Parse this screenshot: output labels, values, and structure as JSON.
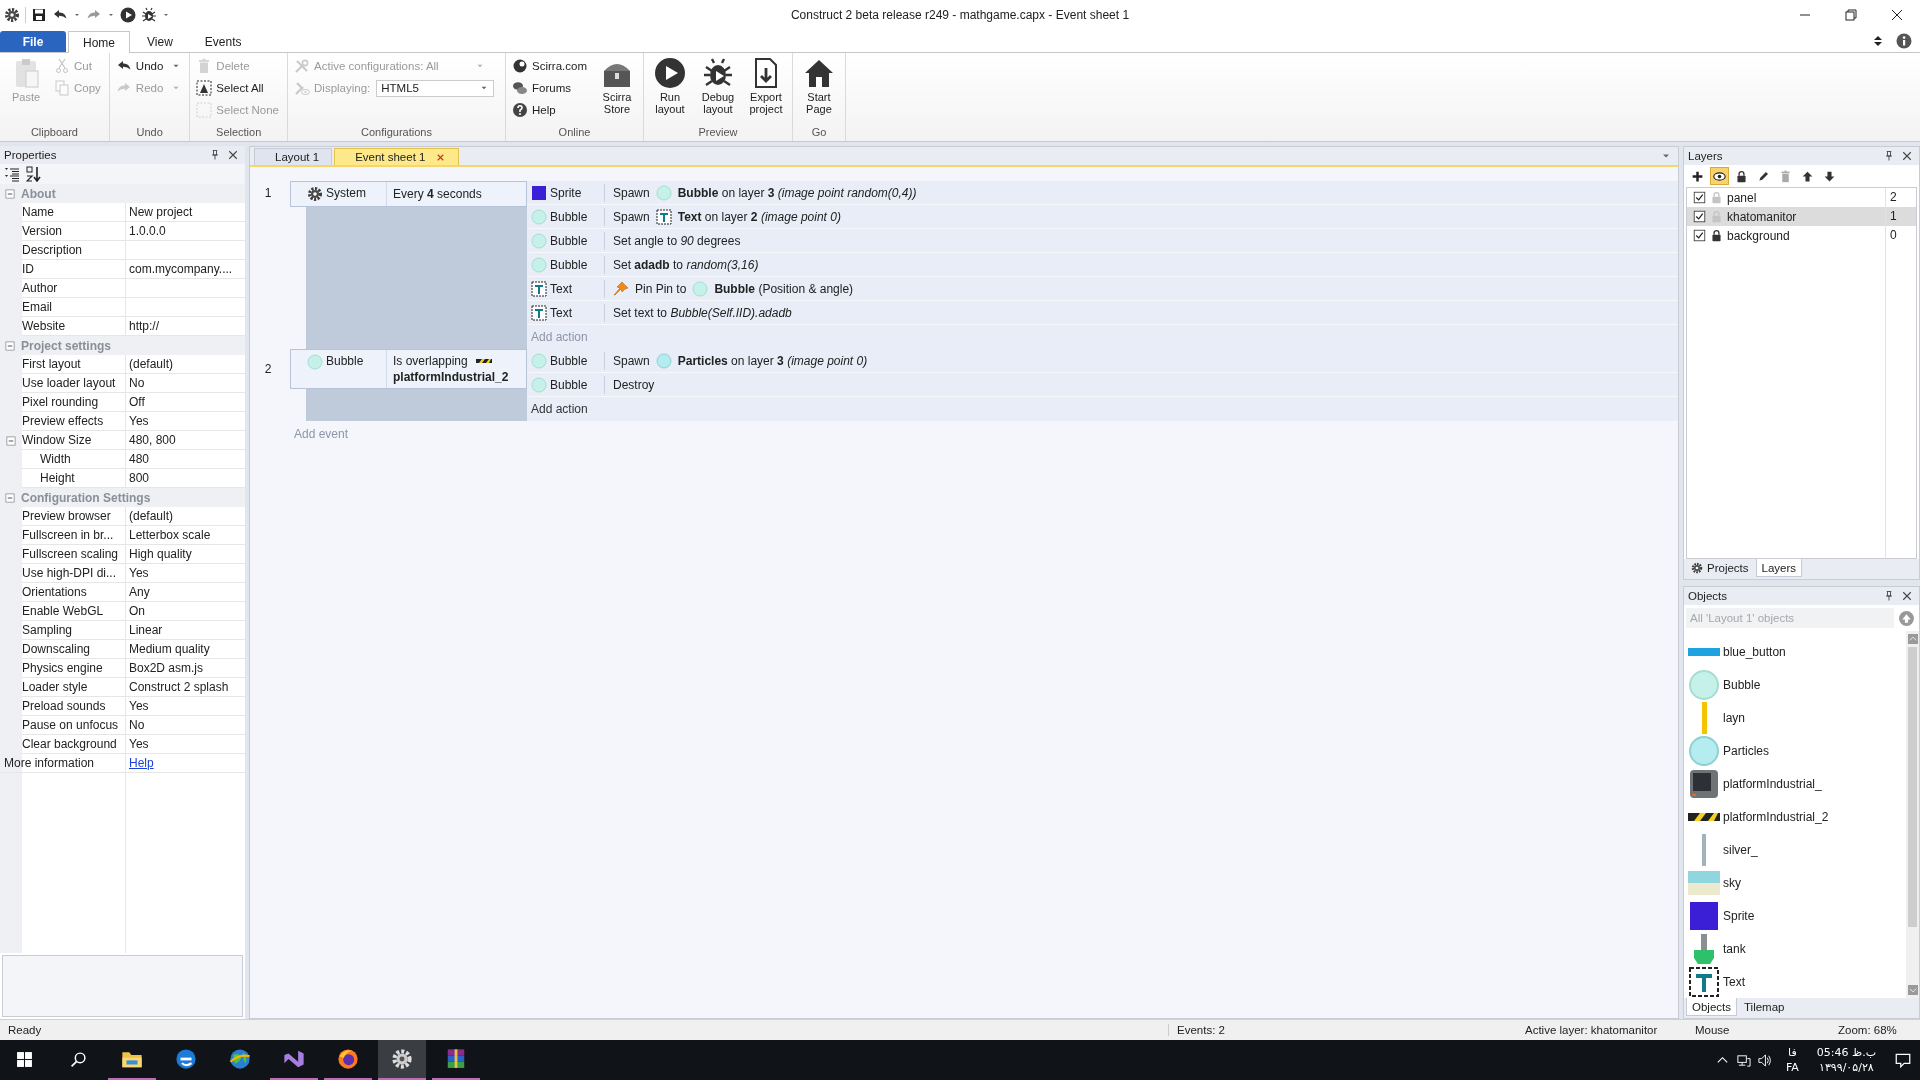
{
  "window": {
    "title": "Construct 2 beta release r249 - mathgame.capx - Event sheet 1"
  },
  "ribbon": {
    "tabs": [
      {
        "label": "File",
        "kind": "file",
        "selected": false
      },
      {
        "label": "Home",
        "kind": "tab",
        "selected": true
      },
      {
        "label": "View",
        "kind": "tab",
        "selected": false
      },
      {
        "label": "Events",
        "kind": "tab",
        "selected": false
      }
    ],
    "groups": [
      {
        "label": "Clipboard",
        "columns": [
          {
            "items": [
              {
                "label": "Paste",
                "kind": "large",
                "disabled": true
              }
            ]
          },
          {
            "items": [
              {
                "label": "Cut",
                "kind": "small",
                "disabled": true
              },
              {
                "label": "Copy",
                "kind": "small",
                "disabled": true
              }
            ]
          }
        ]
      },
      {
        "label": "Undo",
        "columns": [
          {
            "items": [
              {
                "label": "Undo",
                "kind": "small",
                "disabled": false,
                "dropdown": true
              },
              {
                "label": "Redo",
                "kind": "small",
                "disabled": true,
                "dropdown": true
              }
            ]
          }
        ]
      },
      {
        "label": "Selection",
        "columns": [
          {
            "items": [
              {
                "label": "Delete",
                "kind": "small",
                "disabled": true
              },
              {
                "label": "Select All",
                "kind": "small",
                "disabled": false
              },
              {
                "label": "Select None",
                "kind": "small",
                "disabled": true
              }
            ]
          }
        ]
      },
      {
        "label": "Configurations",
        "columns": [
          {
            "items": [
              {
                "label": "Active configurations: All",
                "kind": "small",
                "disabled": true,
                "dropdown": true
              },
              {
                "label": "Displaying:",
                "kind": "combo",
                "disabled": true,
                "value": "HTML5"
              }
            ]
          }
        ]
      },
      {
        "label": "Online",
        "columns": [
          {
            "items": [
              {
                "label": "Scirra.com",
                "kind": "small",
                "disabled": false
              },
              {
                "label": "Forums",
                "kind": "small",
                "disabled": false
              },
              {
                "label": "Help",
                "kind": "small",
                "disabled": false
              }
            ]
          },
          {
            "items": [
              {
                "label": "Scirra Store",
                "kind": "large",
                "disabled": false
              }
            ]
          }
        ]
      },
      {
        "label": "Preview",
        "columns": [
          {
            "items": [
              {
                "label": "Run layout",
                "kind": "large",
                "disabled": false
              }
            ]
          },
          {
            "items": [
              {
                "label": "Debug layout",
                "kind": "large",
                "disabled": false
              }
            ]
          },
          {
            "items": [
              {
                "label": "Export project",
                "kind": "large",
                "disabled": false
              }
            ]
          }
        ]
      },
      {
        "label": "Go",
        "columns": [
          {
            "items": [
              {
                "label": "Start Page",
                "kind": "large",
                "disabled": false
              }
            ]
          }
        ]
      }
    ]
  },
  "properties": {
    "title": "Properties",
    "sections": [
      {
        "label": "About",
        "expanded": true,
        "rows": [
          {
            "name": "Name",
            "value": "New project"
          },
          {
            "name": "Version",
            "value": "1.0.0.0"
          },
          {
            "name": "Description"
          },
          {
            "name": "ID",
            "value": "com.mycompany...."
          },
          {
            "name": "Author"
          },
          {
            "name": "Email"
          },
          {
            "name": "Website",
            "value": "http://"
          }
        ]
      },
      {
        "label": "Project settings",
        "expanded": true,
        "rows": [
          {
            "name": "First layout",
            "value": "(default)"
          },
          {
            "name": "Use loader layout",
            "value": "No"
          },
          {
            "name": "Pixel rounding",
            "value": "Off"
          },
          {
            "name": "Preview effects",
            "value": "Yes"
          },
          {
            "name": "Window Size",
            "value": "480, 800",
            "expanded": true,
            "children": [
              {
                "name": "Width",
                "value": "480"
              },
              {
                "name": "Height",
                "value": "800"
              }
            ]
          }
        ]
      },
      {
        "label": "Configuration Settings",
        "expanded": true,
        "rows": [
          {
            "name": "Preview browser",
            "value": "(default)"
          },
          {
            "name": "Fullscreen in br...",
            "value": "Letterbox scale"
          },
          {
            "name": "Fullscreen scaling",
            "value": "High quality"
          },
          {
            "name": "Use high-DPI di...",
            "value": "Yes"
          },
          {
            "name": "Orientations",
            "value": "Any"
          },
          {
            "name": "Enable WebGL",
            "value": "On"
          },
          {
            "name": "Sampling",
            "value": "Linear"
          },
          {
            "name": "Downscaling",
            "value": "Medium quality"
          },
          {
            "name": "Physics engine",
            "value": "Box2D asm.js"
          },
          {
            "name": "Loader style",
            "value": "Construct 2 splash"
          },
          {
            "name": "Preload sounds",
            "value": "Yes"
          },
          {
            "name": "Pause on unfocus",
            "value": "No"
          },
          {
            "name": "Clear background",
            "value": "Yes"
          }
        ]
      }
    ],
    "footer": {
      "name": "More information",
      "link": "Help"
    }
  },
  "editor": {
    "tabs": [
      {
        "label": "Layout 1",
        "selected": false,
        "closable": false
      },
      {
        "label": "Event sheet 1",
        "selected": true,
        "closable": true
      }
    ],
    "events": [
      {
        "number": "1",
        "condition": {
          "object": "System",
          "kind": "system",
          "parts": [
            {
              "kind": "text",
              "text": "Every **4** seconds"
            }
          ]
        },
        "actions": [
          {
            "object": "Sprite",
            "kind": "sprite",
            "parts": [
              {
                "kind": "text",
                "text": "Spawn"
              },
              {
                "kind": "bubble"
              },
              {
                "kind": "text",
                "text": "**Bubble** on layer **3** *(image point random(0,4))*"
              }
            ]
          },
          {
            "object": "Bubble",
            "kind": "bubble",
            "parts": [
              {
                "kind": "text",
                "text": "Spawn"
              },
              {
                "kind": "text_object"
              },
              {
                "kind": "text",
                "text": "**Text** on layer **2** *(image point 0)*"
              }
            ]
          },
          {
            "object": "Bubble",
            "kind": "bubble",
            "parts": [
              {
                "kind": "text",
                "text": "Set angle to *90* degrees"
              }
            ]
          },
          {
            "object": "Bubble",
            "kind": "bubble",
            "parts": [
              {
                "kind": "text",
                "text": "Set **adadb** to *random(3,16)*"
              }
            ]
          },
          {
            "object": "Text",
            "kind": "text_object",
            "parts": [
              {
                "kind": "pin"
              },
              {
                "kind": "text",
                "text": "Pin Pin to"
              },
              {
                "kind": "bubble"
              },
              {
                "kind": "text",
                "text": "**Bubble** (Position & angle)"
              }
            ]
          },
          {
            "object": "Text",
            "kind": "text_object",
            "parts": [
              {
                "kind": "text",
                "text": "Set text to *Bubble(Self.IID).adadb*"
              }
            ]
          }
        ],
        "add_action": {
          "label": "Add action",
          "muted": true
        }
      },
      {
        "number": "2",
        "condition": {
          "object": "Bubble",
          "kind": "bubble",
          "parts": [
            {
              "kind": "text",
              "text": "Is overlapping"
            },
            {
              "kind": "platform2"
            },
            {
              "kind": "text",
              "text": "**platformIndustrial_2**"
            }
          ]
        },
        "actions": [
          {
            "object": "Bubble",
            "kind": "bubble",
            "parts": [
              {
                "kind": "text",
                "text": "Spawn"
              },
              {
                "kind": "particles"
              },
              {
                "kind": "text",
                "text": "**Particles** on layer **3** *(image point 0)*"
              }
            ]
          },
          {
            "object": "Bubble",
            "kind": "bubble",
            "parts": [
              {
                "kind": "text",
                "text": "Destroy"
              }
            ]
          }
        ],
        "add_action": {
          "label": "Add action",
          "muted": false
        }
      }
    ],
    "add_event": "Add event"
  },
  "layers": {
    "title": "Layers",
    "items": [
      {
        "name": "panel",
        "visible": true,
        "locked": false,
        "number": "2",
        "selected": false
      },
      {
        "name": "khatomanitor",
        "visible": true,
        "locked": false,
        "number": "1",
        "selected": true
      },
      {
        "name": "background",
        "visible": true,
        "locked": true,
        "number": "0",
        "selected": false
      }
    ],
    "tabs": [
      {
        "label": "Projects",
        "selected": false
      },
      {
        "label": "Layers",
        "selected": true
      }
    ]
  },
  "objects": {
    "title": "Objects",
    "filter": {
      "placeholder": "All 'Layout 1' objects"
    },
    "items": [
      {
        "name": "blue_button",
        "kind": "bar"
      },
      {
        "name": "Bubble",
        "kind": "bubble"
      },
      {
        "name": "layn",
        "kind": "pole"
      },
      {
        "name": "Particles",
        "kind": "particles"
      },
      {
        "name": "platformIndustrial_",
        "kind": "monitor"
      },
      {
        "name": "platformIndustrial_2",
        "kind": "platform2"
      },
      {
        "name": "silver_",
        "kind": "rod"
      },
      {
        "name": "sky",
        "kind": "sky"
      },
      {
        "name": "Sprite",
        "kind": "sprite"
      },
      {
        "name": "tank",
        "kind": "tank"
      },
      {
        "name": "Text",
        "kind": "text_object"
      }
    ],
    "tabs": [
      {
        "label": "Objects",
        "selected": true
      },
      {
        "label": "Tilemap",
        "selected": false
      }
    ]
  },
  "status_bar": [
    "Ready",
    "Events: 2",
    "Active layer: khatomanitor",
    "Mouse",
    "Zoom: 68%"
  ],
  "taskbar": {
    "apps": [
      {
        "running": true,
        "active": false
      },
      {
        "running": false,
        "active": false
      },
      {
        "running": false,
        "active": false
      },
      {
        "running": true,
        "active": false
      },
      {
        "running": true,
        "active": false
      },
      {
        "running": true,
        "active": true
      },
      {
        "running": true,
        "active": false
      }
    ],
    "language": "فا",
    "lang_code": "FA",
    "time": "05:46 ب.ظ",
    "date": "۱۳۹۹/۰۵/۲۸"
  }
}
